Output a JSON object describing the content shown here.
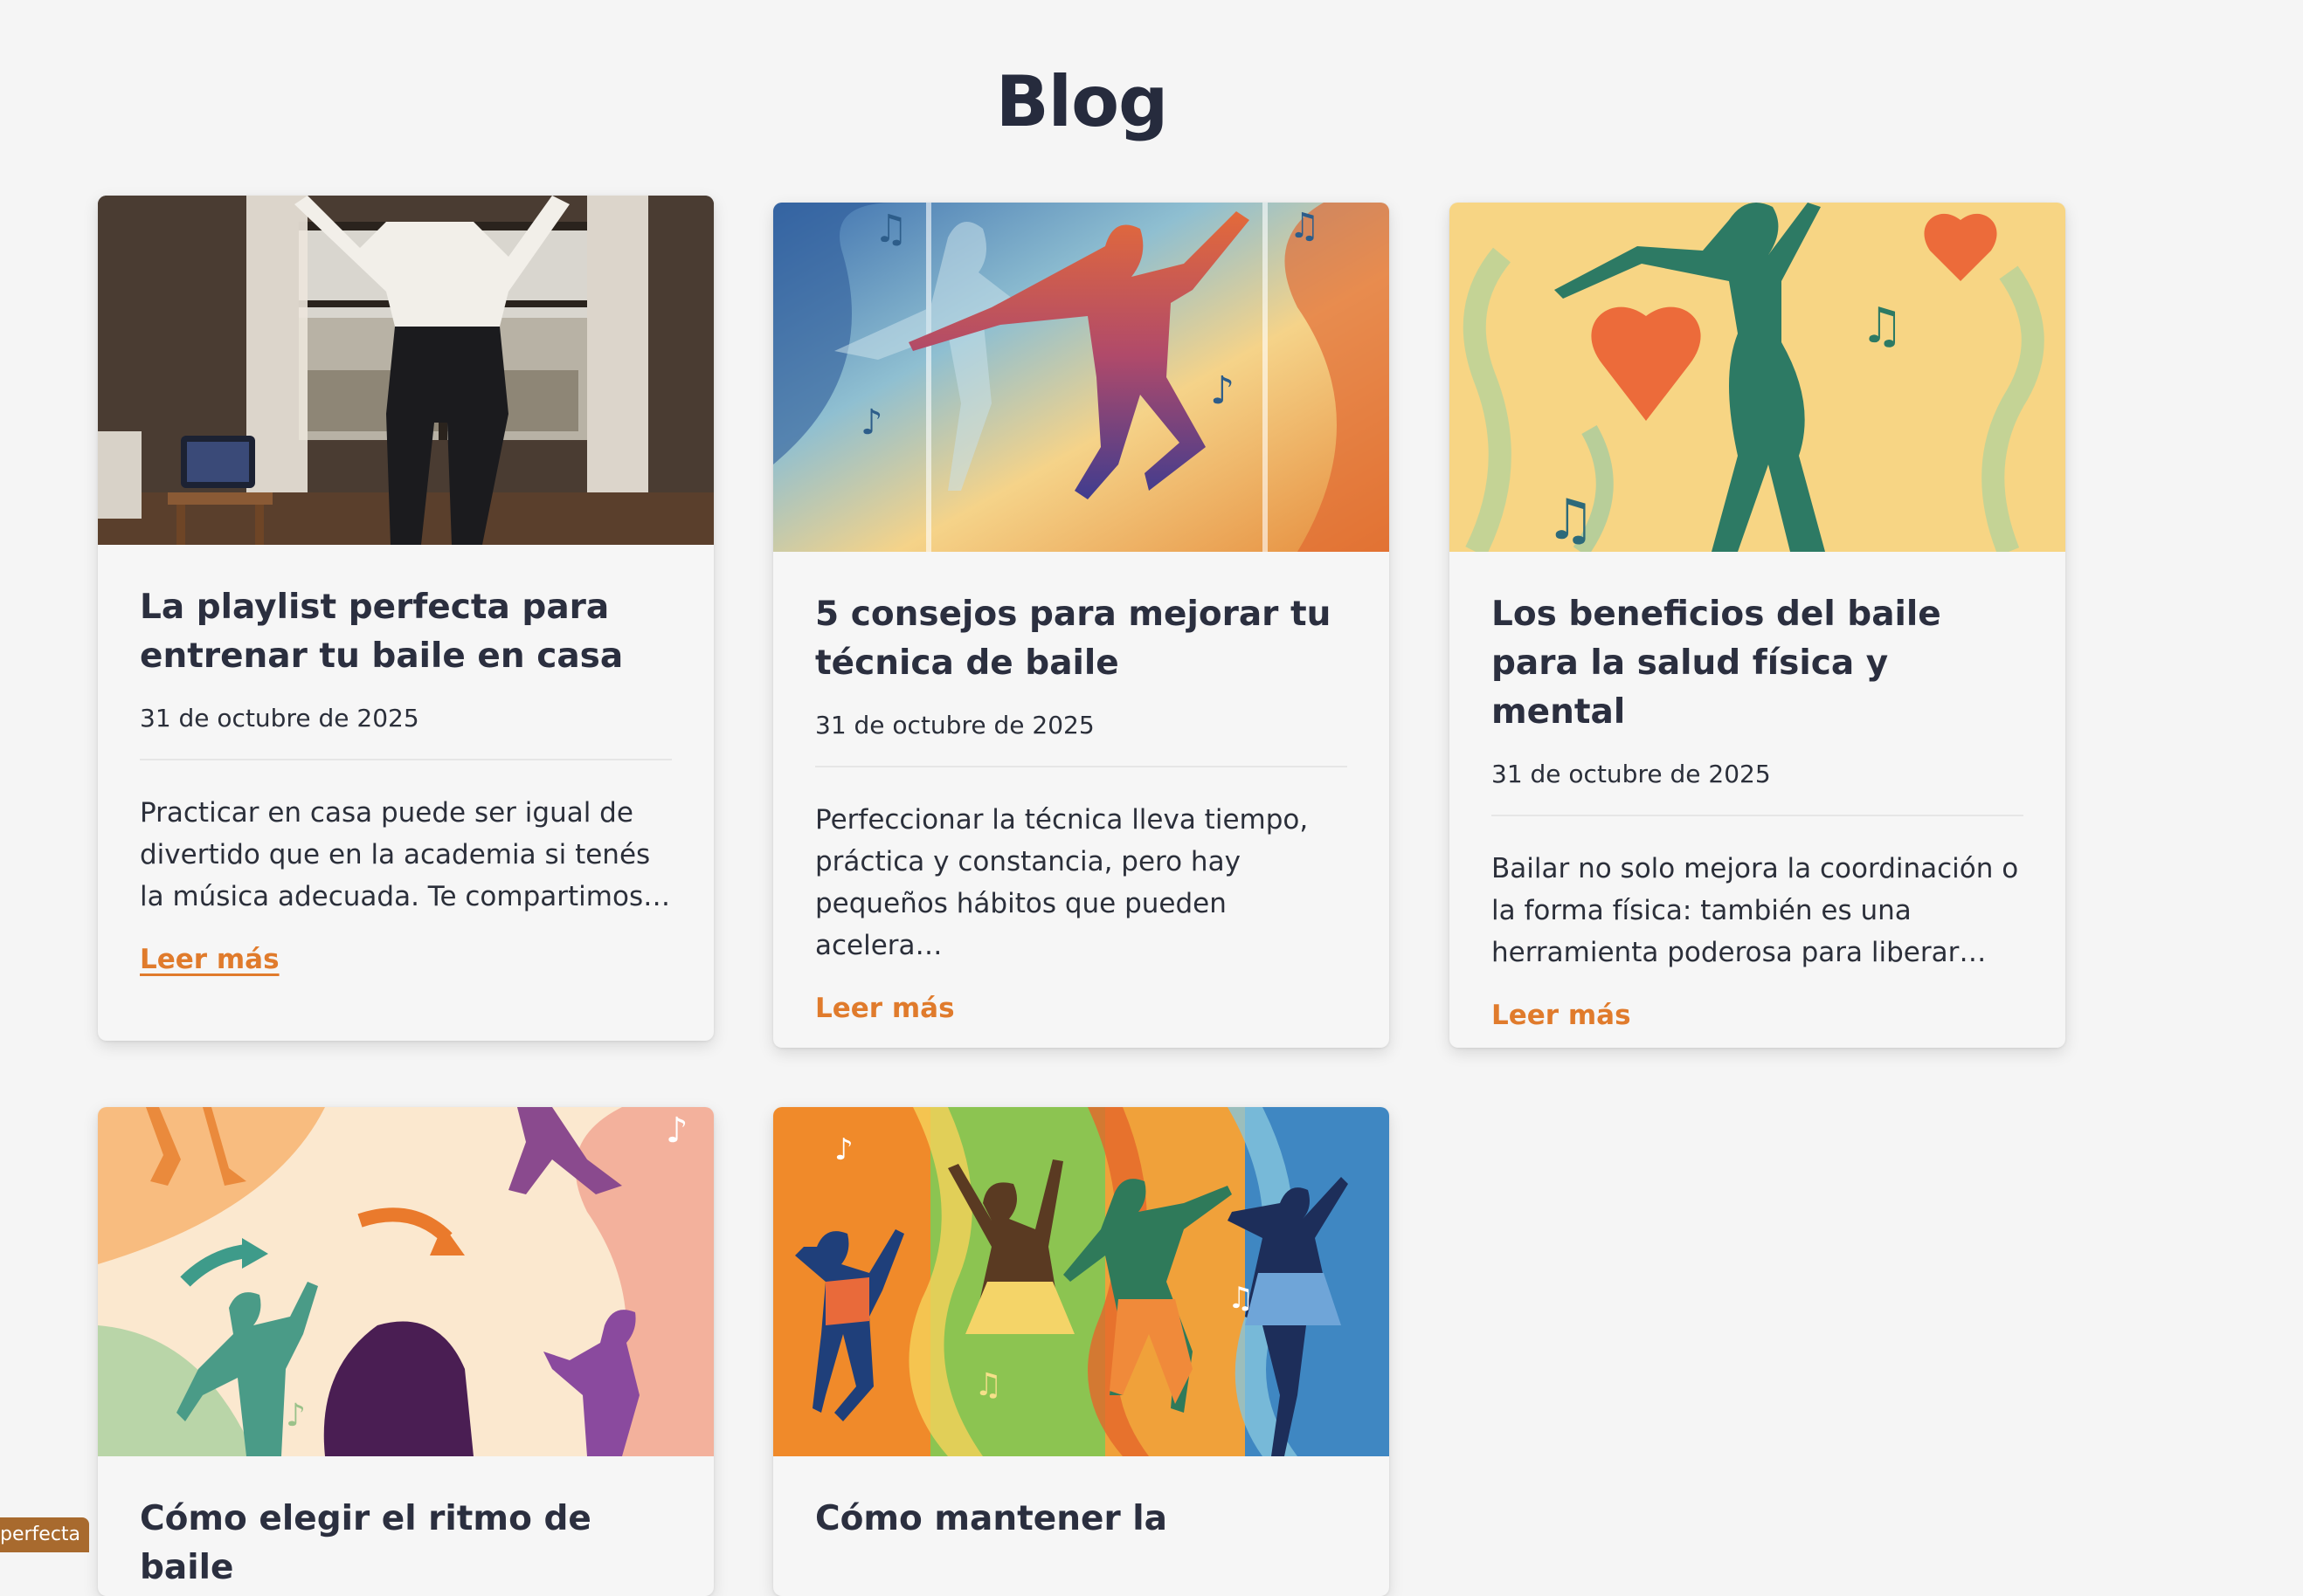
{
  "page": {
    "title": "Blog"
  },
  "posts": [
    {
      "title": "La playlist perfecta para entrenar tu baile en casa",
      "date": "31 de octubre de 2025",
      "excerpt": "Practicar en casa puede ser igual de divertido que en la academia si tenés la música adecuada. Te compartimos…",
      "link": "Leer más",
      "image": "woman-dancing-at-home-photo"
    },
    {
      "title": "5 consejos para mejorar tu técnica de baile",
      "date": "31 de octubre de 2025",
      "excerpt": "Perfeccionar la técnica lleva tiempo, práctica y constancia, pero hay pequeños hábitos que pueden acelera…",
      "link": "Leer más",
      "image": "dancer-silhouette-illustration"
    },
    {
      "title": "Los beneficios del baile para la salud física y mental",
      "date": "31 de octubre de 2025",
      "excerpt": "Bailar no solo mejora la coordinación o la forma física: también es una herramienta poderosa para liberar…",
      "link": "Leer más",
      "image": "dancer-with-hearts-illustration"
    },
    {
      "title": "Cómo elegir el ritmo de baile",
      "image": "dance-styles-illustration"
    },
    {
      "title": "Cómo mantener la",
      "image": "group-dancing-seasons-illustration"
    }
  ],
  "corner_tag": {
    "label": "perfecta"
  },
  "colors": {
    "background": "#f5f5f5",
    "accent_link": "#e07b2c",
    "heading": "#262b3d",
    "tag_background": "#a86a2e"
  }
}
